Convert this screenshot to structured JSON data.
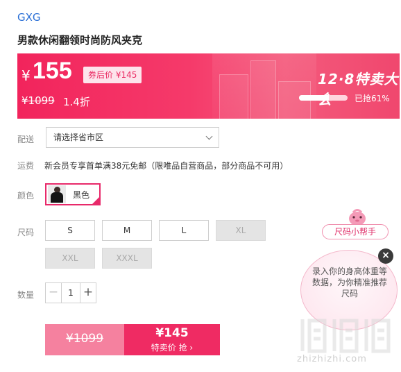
{
  "product": {
    "brand": "GXG",
    "title": "男款休闲翻领时尚防风夹克"
  },
  "banner": {
    "currency": "¥",
    "price": "155",
    "coupon_tag": "券后价 ¥145",
    "original_price": "¥1099",
    "discount": "1.4折",
    "event_name": "12·8特卖大会",
    "sold_progress": 0.61,
    "sold_text": "已抢61%"
  },
  "delivery": {
    "label": "配送",
    "select_value": "请选择省市区"
  },
  "shipping": {
    "label": "运费",
    "text": "新会员专享首单满38元免邮（限唯品自营商品，部分商品不可用）"
  },
  "color": {
    "label": "颜色",
    "option": "黑色"
  },
  "size": {
    "label": "尺码",
    "options": [
      {
        "label": "S",
        "disabled": false
      },
      {
        "label": "M",
        "disabled": false
      },
      {
        "label": "L",
        "disabled": false
      },
      {
        "label": "XL",
        "disabled": true
      },
      {
        "label": "XXL",
        "disabled": true
      },
      {
        "label": "XXXL",
        "disabled": true
      }
    ]
  },
  "quantity": {
    "label": "数量",
    "minus": "−",
    "value": "1",
    "plus": "+"
  },
  "buy": {
    "original": "¥1099",
    "price": "¥145",
    "cta": "特卖价 抢 ›"
  },
  "helper": {
    "pill": "尺码小帮手",
    "bubble": "录入你的身高体重等数据，为你精准推荐尺码",
    "close": "×"
  },
  "watermark": {
    "site": "zhizhizhi.com"
  },
  "colors": {
    "accent": "#ef2b63",
    "brand_link": "#2a6fd6"
  }
}
